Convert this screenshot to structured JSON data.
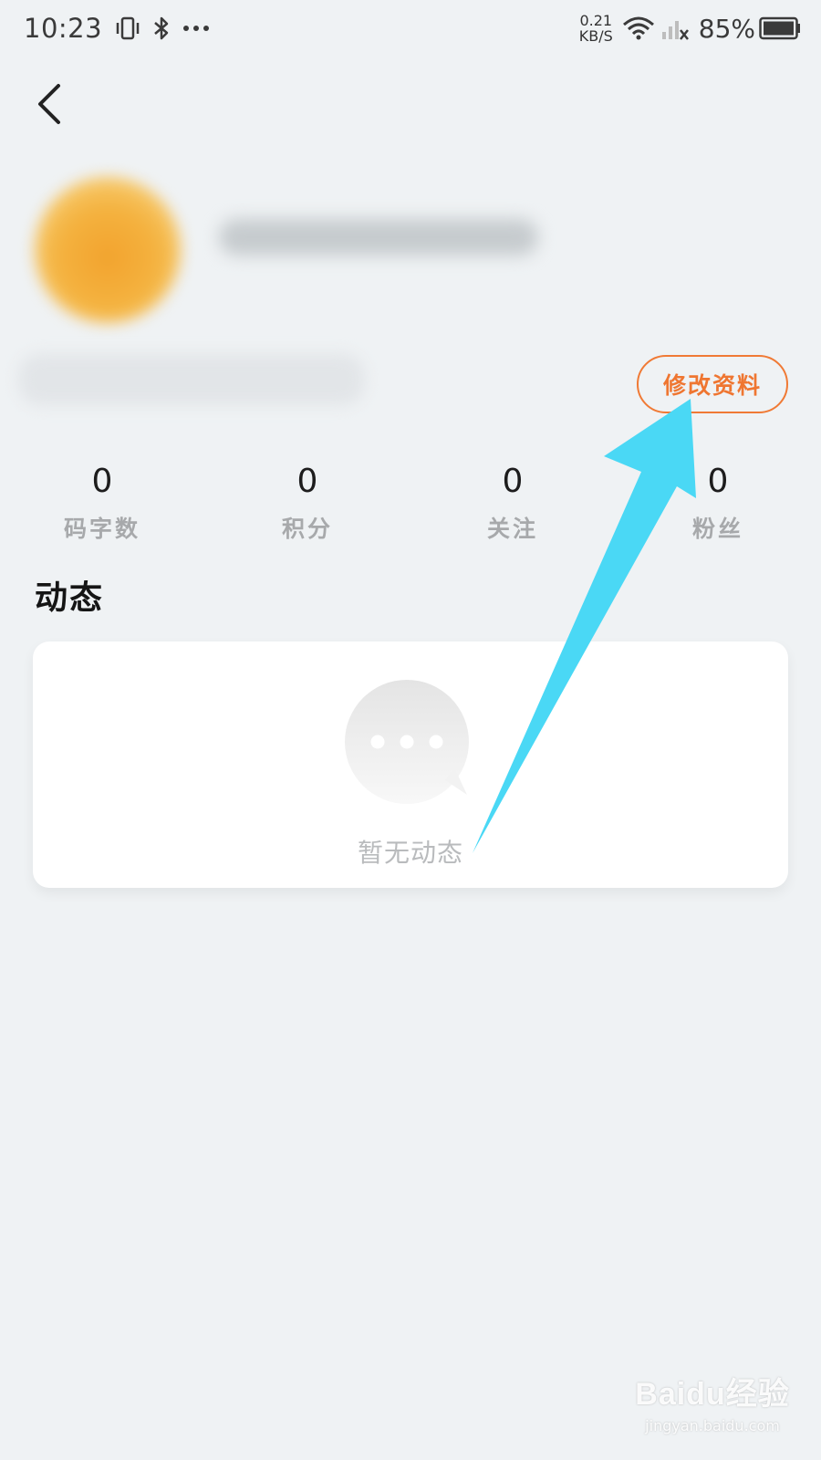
{
  "status_bar": {
    "time": "10:23",
    "network_speed_value": "0.21",
    "network_speed_unit": "KB/S",
    "battery_percent": "85%",
    "icons": [
      "vibrate-icon",
      "bluetooth-icon",
      "more-dots-icon",
      "wifi-icon",
      "signal-icon",
      "battery-icon"
    ]
  },
  "header": {
    "back_icon": "chevron-left-icon"
  },
  "profile": {
    "edit_button_label": "修改资料",
    "accent_color": "#ef7631"
  },
  "stats": [
    {
      "value": "0",
      "label": "码字数"
    },
    {
      "value": "0",
      "label": "积分"
    },
    {
      "value": "0",
      "label": "关注"
    },
    {
      "value": "0",
      "label": "粉丝"
    }
  ],
  "feed": {
    "section_title": "动态",
    "empty_icon": "chat-bubble-icon",
    "empty_text": "暂无动态"
  },
  "annotation": {
    "arrow_color": "#4ad8f5"
  },
  "watermark": {
    "logo_text": "Baidu经验",
    "url_text": "jingyan.baidu.com"
  }
}
